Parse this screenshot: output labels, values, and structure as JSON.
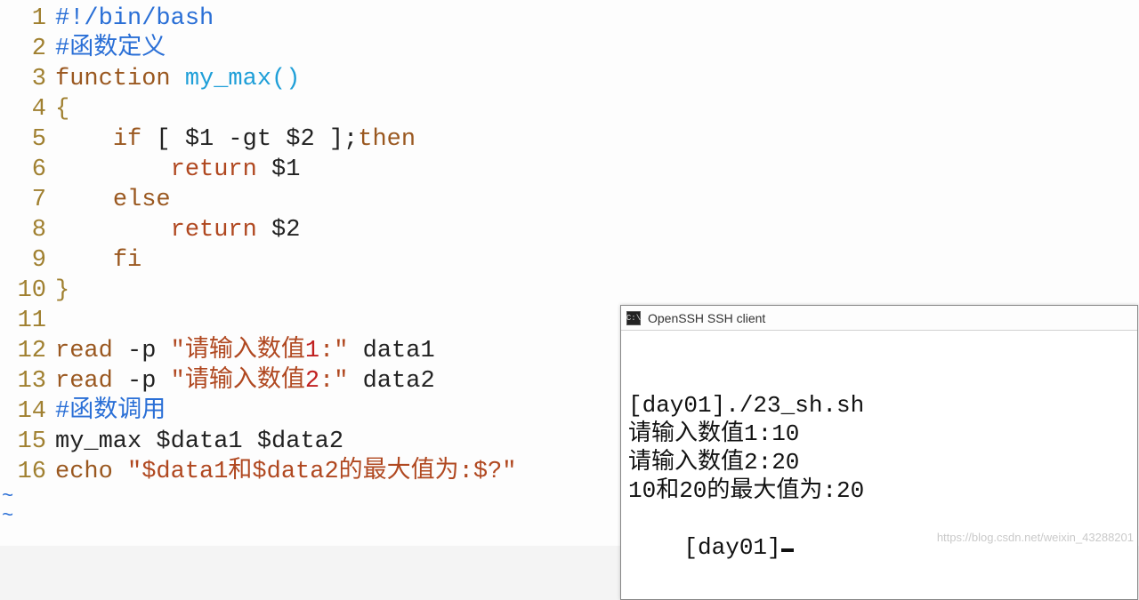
{
  "editor": {
    "lines": [
      {
        "num": "1",
        "tokens": [
          [
            "c-comment",
            "#!/bin/bash"
          ]
        ]
      },
      {
        "num": "2",
        "tokens": [
          [
            "c-comment",
            "#函数定义"
          ]
        ]
      },
      {
        "num": "3",
        "tokens": [
          [
            "c-keyword",
            "function "
          ],
          [
            "c-func",
            "my_max"
          ],
          [
            "c-id",
            "()"
          ]
        ]
      },
      {
        "num": "4",
        "tokens": [
          [
            "c-brace",
            "{"
          ]
        ]
      },
      {
        "num": "5",
        "tokens": [
          [
            "c-plain",
            "    "
          ],
          [
            "c-keyword",
            "if"
          ],
          [
            "c-plain",
            " [ $1 -gt $2 ];"
          ],
          [
            "c-keyword",
            "then"
          ]
        ]
      },
      {
        "num": "6",
        "tokens": [
          [
            "c-plain",
            "        "
          ],
          [
            "c-return",
            "return"
          ],
          [
            "c-plain",
            " $1"
          ]
        ]
      },
      {
        "num": "7",
        "tokens": [
          [
            "c-plain",
            "    "
          ],
          [
            "c-keyword",
            "else"
          ]
        ]
      },
      {
        "num": "8",
        "tokens": [
          [
            "c-plain",
            "        "
          ],
          [
            "c-return",
            "return"
          ],
          [
            "c-plain",
            " $2"
          ]
        ]
      },
      {
        "num": "9",
        "tokens": [
          [
            "c-plain",
            "    "
          ],
          [
            "c-keyword",
            "fi"
          ]
        ]
      },
      {
        "num": "10",
        "tokens": [
          [
            "c-brace",
            "}"
          ]
        ]
      },
      {
        "num": "11",
        "tokens": [
          [
            "c-plain",
            ""
          ]
        ]
      },
      {
        "num": "12",
        "tokens": [
          [
            "c-keyword",
            "read"
          ],
          [
            "c-plain",
            " -p "
          ],
          [
            "c-dq",
            "\"请输入数值"
          ],
          [
            "c-num",
            "1"
          ],
          [
            "c-dq",
            ":\""
          ],
          [
            "c-plain",
            " data1"
          ]
        ]
      },
      {
        "num": "13",
        "tokens": [
          [
            "c-keyword",
            "read"
          ],
          [
            "c-plain",
            " -p "
          ],
          [
            "c-dq",
            "\"请输入数值"
          ],
          [
            "c-num",
            "2"
          ],
          [
            "c-dq",
            ":\""
          ],
          [
            "c-plain",
            " data2"
          ]
        ]
      },
      {
        "num": "14",
        "tokens": [
          [
            "c-comment",
            "#函数调用"
          ]
        ]
      },
      {
        "num": "15",
        "tokens": [
          [
            "c-plain",
            "my_max $data1 $data2"
          ]
        ]
      },
      {
        "num": "16",
        "tokens": [
          [
            "c-keyword",
            "echo"
          ],
          [
            "c-plain",
            " "
          ],
          [
            "c-dq",
            "\"$data1和$data2的最大值为:$?\""
          ]
        ]
      }
    ],
    "tilde": "~"
  },
  "terminal": {
    "title": "OpenSSH SSH client",
    "icon_label": "C:\\",
    "lines": [
      "[day01]./23_sh.sh",
      "请输入数值1:10",
      "请输入数值2:20",
      "10和20的最大值为:20"
    ],
    "prompt": "[day01]"
  },
  "watermark": "https://blog.csdn.net/weixin_43288201"
}
